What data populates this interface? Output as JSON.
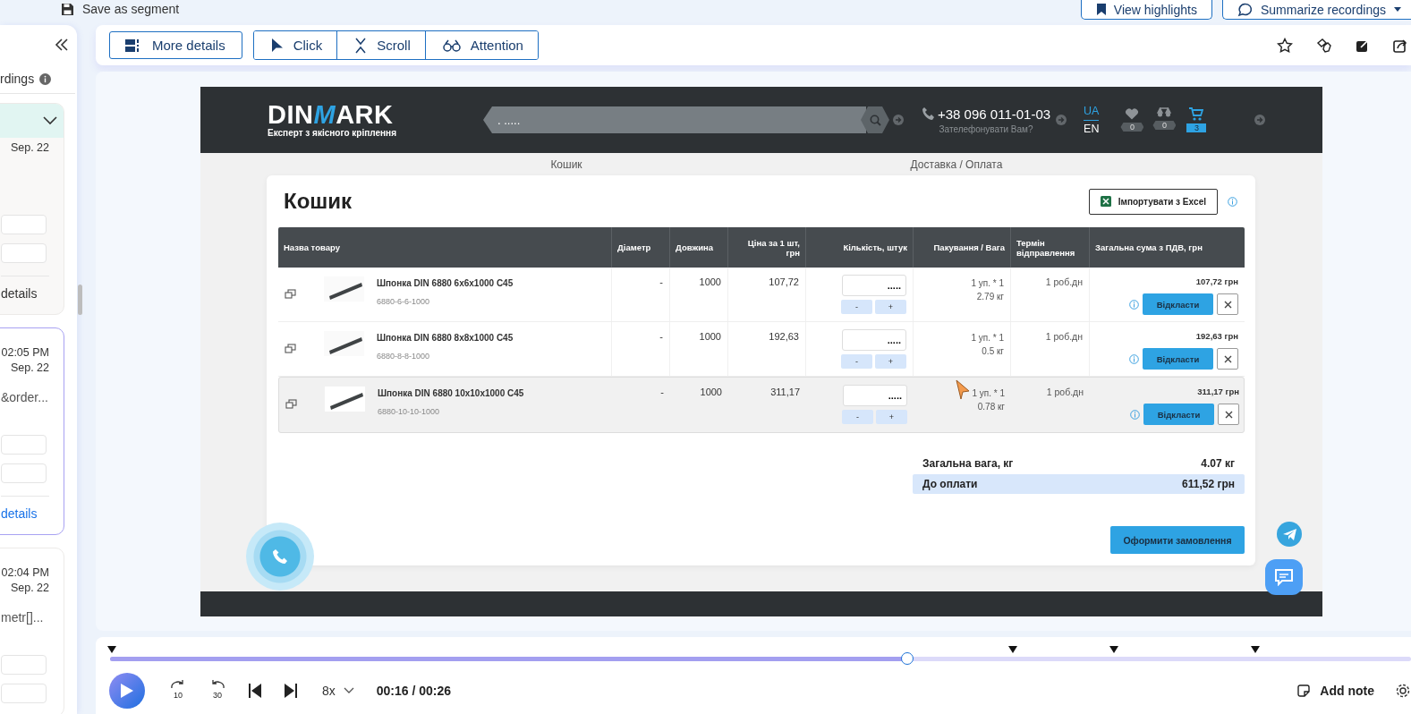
{
  "top_bar": {
    "save_segment": "Save as segment",
    "buttons": [
      {
        "kind": "highlights",
        "label": "View highlights"
      },
      {
        "kind": "summarize",
        "label": "Summarize recordings"
      }
    ]
  },
  "sidebar": {
    "heading": "rdings",
    "recordings": [
      {
        "expanded": true,
        "selected": false,
        "date": "Sep. 22",
        "link": "details"
      },
      {
        "expanded": false,
        "selected": true,
        "time": "02:05 PM",
        "date": "Sep. 22",
        "snippet": "&order...",
        "link": "details"
      },
      {
        "expanded": false,
        "selected": false,
        "time": "02:04 PM",
        "date": "Sep. 22",
        "snippet": "metr[]..."
      }
    ]
  },
  "toolbar": {
    "details_button": "More details",
    "modes": [
      {
        "kind": "click",
        "label": "Click",
        "selected": false
      },
      {
        "kind": "scroll",
        "label": "Scroll",
        "selected": false
      },
      {
        "kind": "attention",
        "label": "Attention",
        "selected": false
      }
    ]
  },
  "site": {
    "logo": {
      "start": "DIN",
      "accent": "M",
      "end": "ARK"
    },
    "tagline": "Експерт з якісного кріплення",
    "search_placeholder": ". .....",
    "phone": "+38 096 011-01-03",
    "callback": "Зателефонувати Вам?",
    "languages": [
      {
        "label": "UA",
        "selected": true
      },
      {
        "label": "EN",
        "selected": false
      }
    ],
    "counters": [
      {
        "kind": "favorites",
        "count": "0",
        "active": false
      },
      {
        "kind": "compare",
        "count": "0",
        "active": false
      },
      {
        "kind": "cart",
        "count": "3",
        "active": true
      }
    ],
    "steps": [
      "Кошик",
      "Доставка / Оплата"
    ],
    "title": "Кошик",
    "import_button": "Імпортувати з Excel",
    "columns": [
      "Назва товару",
      "Діаметр",
      "Довжина",
      "Ціна за 1 шт, грн",
      "Кількість, штук",
      "Пакування / Вага",
      "Термін відправлення",
      "Загальна сума з ПДВ, грн"
    ],
    "rows": [
      {
        "name": "Шпонка DIN 6880 6x6x1000 C45",
        "sku": "6880-6-6-1000",
        "diameter": "-",
        "length": "1000",
        "price": "107,72",
        "quantity": ".....",
        "minus": "-",
        "plus": "+",
        "package": "1 уп. * 1",
        "weight": "2.79 кг",
        "shipping": "1 роб.дн",
        "total": "107,72 грн",
        "defer": "Відкласти",
        "hovered": false
      },
      {
        "name": "Шпонка DIN 6880 8x8x1000 C45",
        "sku": "6880-8-8-1000",
        "diameter": "-",
        "length": "1000",
        "price": "192,63",
        "quantity": ".....",
        "minus": "-",
        "plus": "+",
        "package": "1 уп. * 1",
        "weight": "0.5 кг",
        "shipping": "1 роб.дн",
        "total": "192,63 грн",
        "defer": "Відкласти",
        "hovered": false
      },
      {
        "name": "Шпонка DIN 6880 10x10x1000 C45",
        "sku": "6880-10-10-1000",
        "diameter": "-",
        "length": "1000",
        "price": "311,17",
        "quantity": ".....",
        "minus": "-",
        "plus": "+",
        "package": "1 уп. * 1",
        "weight": "0.78 кг",
        "shipping": "1 роб.дн",
        "total": "311,17 грн",
        "defer": "Відкласти",
        "hovered": true
      }
    ],
    "summary": {
      "weight_label": "Загальна вага, кг",
      "weight": "4.07 кг",
      "total_label": "До оплати",
      "total": "611,52 грн"
    },
    "order_button": "Оформити замовлення"
  },
  "player": {
    "timeline": {
      "level": 0.613
    },
    "rewind": "10",
    "forward": "30",
    "speed": "8x",
    "time": "00:16 / 00:26",
    "add_note": "Add note"
  }
}
